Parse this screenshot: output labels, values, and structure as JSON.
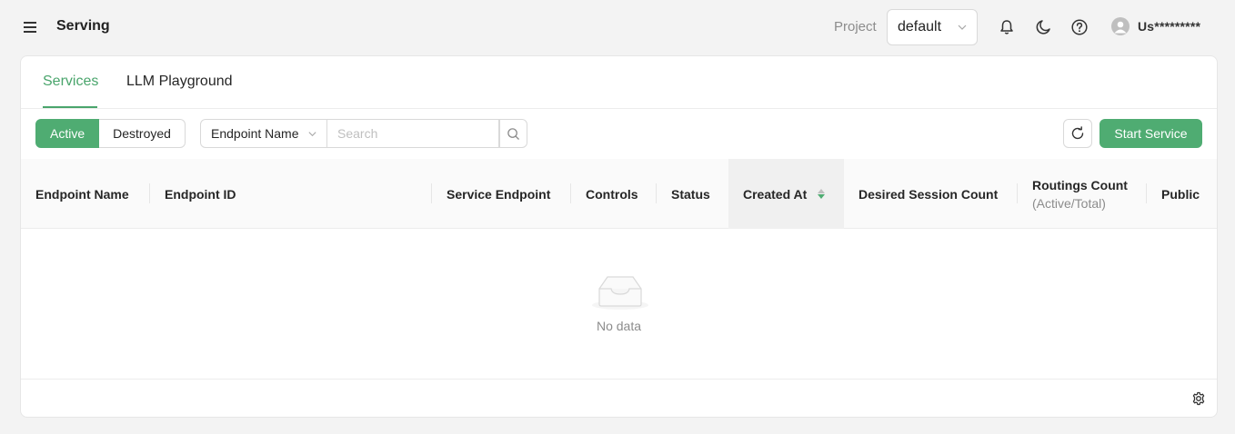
{
  "header": {
    "title": "Serving",
    "project_label": "Project",
    "project_value": "default",
    "user_name": "Us*********"
  },
  "tabs": [
    {
      "label": "Services",
      "active": true
    },
    {
      "label": "LLM Playground",
      "active": false
    }
  ],
  "toolbar": {
    "status_filter": [
      "Active",
      "Destroyed"
    ],
    "selected_status": "Active",
    "search_field": "Endpoint Name",
    "search_placeholder": "Search",
    "start_service_label": "Start Service"
  },
  "table": {
    "columns": [
      {
        "label": "Endpoint Name"
      },
      {
        "label": "Endpoint ID"
      },
      {
        "label": "Service Endpoint"
      },
      {
        "label": "Controls"
      },
      {
        "label": "Status"
      },
      {
        "label": "Created At",
        "sorted": true
      },
      {
        "label": "Desired Session Count"
      },
      {
        "label": "Routings Count",
        "sub": "(Active/Total)"
      },
      {
        "label": "Public"
      }
    ],
    "rows": [],
    "empty_text": "No data"
  },
  "colors": {
    "accent": "#4fac72",
    "accent_text": "#4aa56c",
    "background": "#f3f3f3"
  },
  "icons": [
    "menu-icon",
    "bell-icon",
    "moon-icon",
    "help-icon",
    "user-icon",
    "search-icon",
    "refresh-icon",
    "sort-icon",
    "inbox-icon",
    "gear-icon"
  ]
}
